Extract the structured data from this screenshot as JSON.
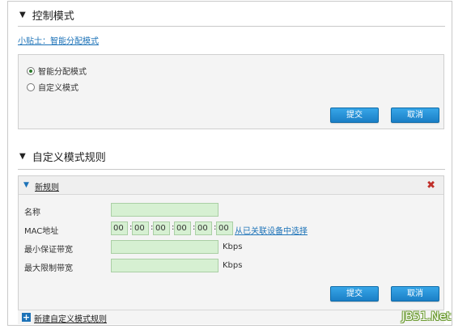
{
  "control_mode": {
    "title": "控制模式",
    "tip_link": "小贴士：智能分配模式",
    "options": [
      {
        "label": "智能分配模式",
        "selected": true
      },
      {
        "label": "自定义模式",
        "selected": false
      }
    ],
    "submit_label": "提交",
    "cancel_label": "取消"
  },
  "custom_rules": {
    "title": "自定义模式规则",
    "new_rule_title": "新规则",
    "fields": {
      "name_label": "名称",
      "mac_label": "MAC地址",
      "mac_values": [
        "00",
        "00",
        "00",
        "00",
        "00",
        "00"
      ],
      "mac_separator": ":",
      "mac_link": "从已关联设备中选择",
      "min_bw_label": "最小保证带宽",
      "max_bw_label": "最大限制带宽",
      "unit": "Kbps"
    },
    "submit_label": "提交",
    "cancel_label": "取消",
    "add_rule_label": "新建自定义模式规则"
  },
  "icons": {
    "collapse": "triangle-down-icon",
    "delete": "close-x-icon",
    "add": "plus-icon"
  },
  "colors": {
    "accent": "#1d73b8",
    "button": "#2590d6",
    "field_bg": "#d6f0d2",
    "delete": "#c0302a"
  },
  "watermark": "JB51.Net"
}
